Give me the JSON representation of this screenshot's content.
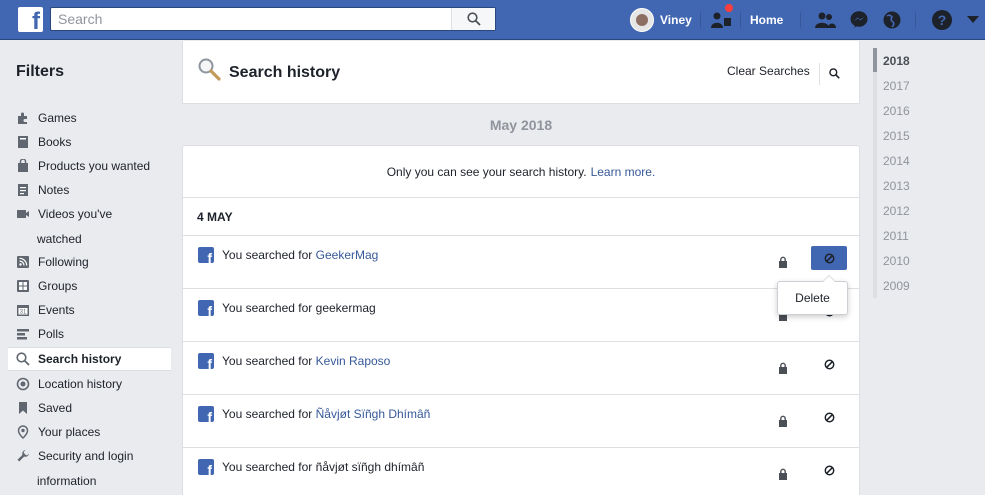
{
  "topbar": {
    "search_placeholder": "Search",
    "profile_name": "Viney",
    "home_label": "Home"
  },
  "sidebar": {
    "title": "Filters",
    "items": [
      {
        "label": "Games",
        "icon": "puzzle-icon"
      },
      {
        "label": "Books",
        "icon": "book-icon"
      },
      {
        "label": "Products you wanted",
        "icon": "bag-icon"
      },
      {
        "label": "Notes",
        "icon": "note-icon"
      },
      {
        "label": "Videos you've",
        "label2": "watched",
        "icon": "video-icon"
      },
      {
        "label": "Following",
        "icon": "rss-icon"
      },
      {
        "label": "Groups",
        "icon": "groups-icon"
      },
      {
        "label": "Events",
        "icon": "calendar-icon"
      },
      {
        "label": "Polls",
        "icon": "poll-icon"
      },
      {
        "label": "Search history",
        "icon": "search-icon",
        "active": true
      },
      {
        "label": "Location history",
        "icon": "location-icon"
      },
      {
        "label": "Saved",
        "icon": "bookmark-icon"
      },
      {
        "label": "Your places",
        "icon": "pin-icon"
      },
      {
        "label": "Security and login",
        "label2": "information",
        "icon": "wrench-icon"
      }
    ]
  },
  "header": {
    "title": "Search history",
    "clear_label": "Clear Searches"
  },
  "month_label": "May 2018",
  "privacy_note": {
    "text": "Only you can see your search history.",
    "link": "Learn more."
  },
  "day_label": "4 MAY",
  "rows": [
    {
      "prefix": "You searched for",
      "query": "GeekerMag",
      "linked": true
    },
    {
      "prefix": "You searched for",
      "query": "geekermag",
      "linked": false
    },
    {
      "prefix": "You searched for",
      "query": "Kevin Raposo",
      "linked": true
    },
    {
      "prefix": "You searched for",
      "query": "Ñåvjøt Sïñgh Dhímâñ",
      "linked": true
    },
    {
      "prefix": "You searched for",
      "query": "ñåvjøt sïñgh dhímâñ",
      "linked": false
    }
  ],
  "delete_popup": "Delete",
  "years": [
    "2018",
    "2017",
    "2016",
    "2015",
    "2014",
    "2013",
    "2012",
    "2011",
    "2010",
    "2009"
  ],
  "active_year": "2018",
  "colors": {
    "brand": "#4267b2",
    "link": "#365899",
    "background": "#e9ebee",
    "notification": "#fa3e3e"
  }
}
